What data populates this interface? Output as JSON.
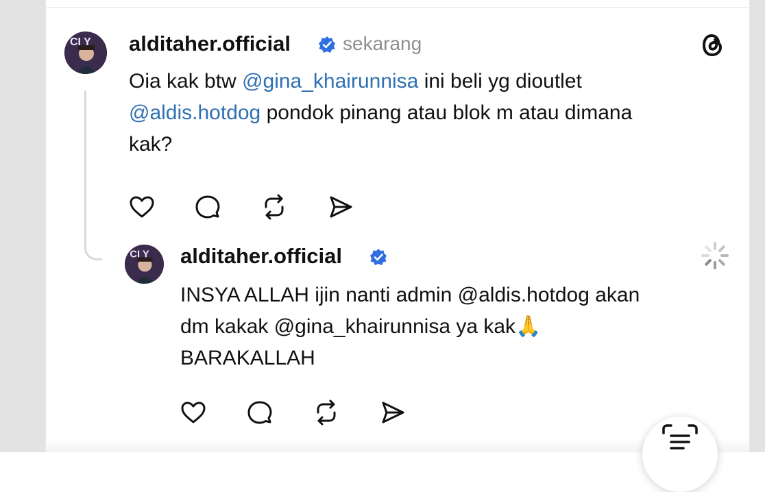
{
  "post": {
    "username": "alditaher.official",
    "timestamp": "sekarang",
    "text_line1_a": "Oia kak btw ",
    "text_line1_mention": "@gina_khairunnisa",
    "text_line1_b": " ini beli yg dioutlet",
    "text_line2_mention": "@aldis.hotdog",
    "text_line2_b": " pondok pinang atau blok m atau dimana",
    "text_line3": "kak?"
  },
  "reply": {
    "username": "alditaher.official",
    "text_line1": "INSYA ALLAH ijin nanti admin @aldis.hotdog akan",
    "text_line2": "dm kakak @gina_khairunnisa ya kak🙏",
    "text_line3": "BARAKALLAH"
  },
  "colors": {
    "mention": "#2f6fb3",
    "verified": "#2f6fe0",
    "muted": "#8e8e8e"
  },
  "icons": [
    "like-icon",
    "comment-icon",
    "repost-icon",
    "share-icon",
    "threads-logo-icon",
    "loading-spinner-icon",
    "scan-text-icon",
    "verified-badge-icon"
  ]
}
